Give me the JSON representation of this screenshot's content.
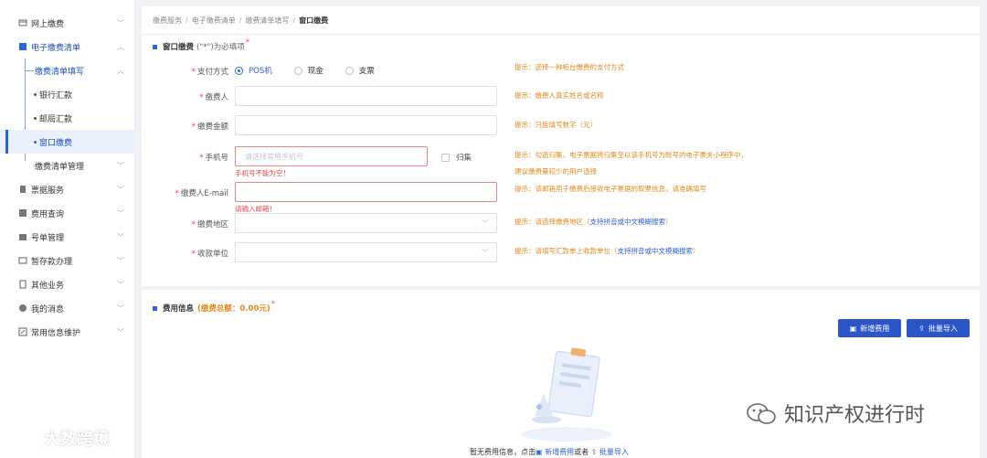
{
  "sidebar": {
    "items": [
      {
        "label": "网上缴费",
        "chev": "﹀"
      },
      {
        "label": "电子缴费清单",
        "chev": "︿"
      },
      {
        "label": "缴费清单填写",
        "chev": "︿"
      },
      {
        "label": "银行汇款"
      },
      {
        "label": "邮局汇款"
      },
      {
        "label": "窗口缴费"
      },
      {
        "label": "缴费清单管理",
        "chev": "﹀"
      },
      {
        "label": "票据服务",
        "chev": "﹀"
      },
      {
        "label": "费用查询",
        "chev": "﹀"
      },
      {
        "label": "号单管理",
        "chev": "﹀"
      },
      {
        "label": "暂存款办理",
        "chev": "﹀"
      },
      {
        "label": "其他业务",
        "chev": "﹀"
      },
      {
        "label": "我的消息",
        "chev": "﹀"
      },
      {
        "label": "常用信息维护",
        "chev": "﹀"
      }
    ]
  },
  "breadcrumb": [
    "缴费服务",
    "电子缴费清单",
    "缴费清单填写",
    "窗口缴费"
  ],
  "breadcrumb_sep": "/",
  "section1": {
    "title": "窗口缴费",
    "note": "(\"*\")为必填项",
    "req": "*"
  },
  "form": {
    "pay_method": {
      "label": "支付方式",
      "star": "*",
      "options": [
        "POS机",
        "现金",
        "支票"
      ],
      "hint": "提示：选择一种柜台缴费的支付方式"
    },
    "payer": {
      "label": "缴费人",
      "star": "*",
      "hint": "提示：缴费人真实姓名或名称"
    },
    "amount": {
      "label": "缴费金额",
      "star": "*",
      "hint": "提示：只能填写数字（元）"
    },
    "phone": {
      "label": "手机号",
      "star": "*",
      "placeholder": "请选择常用手机号",
      "error": "手机号不能为空！",
      "checkbox": "归集",
      "hint1": "提示：勾选归集，电子票据将归集至以该手机号为账号的电子票夹小程序中，",
      "hint2": "建议缴费量较少的用户选择"
    },
    "email": {
      "label": "缴费人E-mail",
      "star": "*",
      "error": "请输入邮箱！",
      "hint": "提示：该邮箱用于缴费后接收电子票据的取票信息，请准确填写"
    },
    "region": {
      "label": "缴费地区",
      "star": "*",
      "chev": "﹀",
      "hint_a": "提示：请选择缴费地区（",
      "hint_b": "支持拼音或中文模糊搜索",
      "hint_c": "）"
    },
    "payee": {
      "label": "收款单位",
      "star": "*",
      "chev": "﹀",
      "hint_a": "提示：请填写汇款单上收款单位（",
      "hint_b": "支持拼音或中文模糊搜索",
      "hint_c": "）"
    }
  },
  "section2": {
    "title": "费用信息",
    "total": "(缴费总额：0.00元)",
    "req": "*"
  },
  "buttons": {
    "add_fee": "新增费用",
    "add_fee_icon": "▣",
    "batch_import": "批量导入",
    "batch_import_icon": "⇪"
  },
  "empty": {
    "prefix": "暂无费用信息，点击",
    "icon1": "▣",
    "link1": "新增费用",
    "mid": "或者",
    "icon2": "⇪",
    "link2": "批量导入"
  },
  "watermark_left": "大数跨境",
  "watermark_right": "知识产权进行时",
  "colors": {
    "primary": "#2c56c8",
    "hint": "#e08a1e",
    "error": "#e5484d"
  }
}
